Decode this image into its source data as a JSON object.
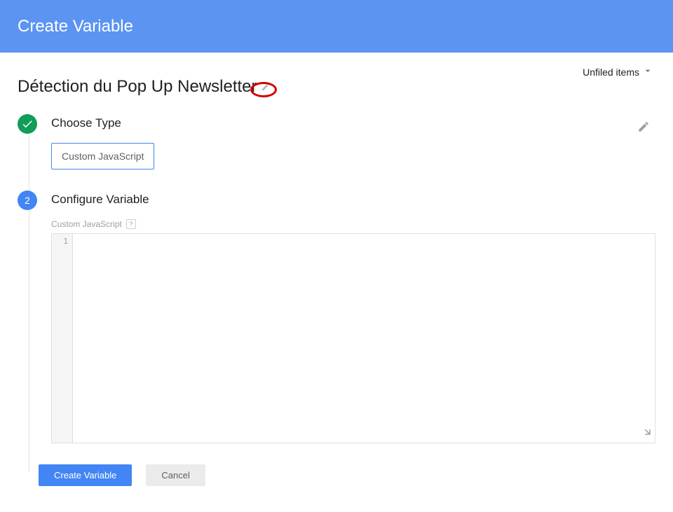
{
  "header": {
    "title": "Create Variable"
  },
  "folder": {
    "label": "Unfiled items"
  },
  "variable": {
    "name": "Détection du Pop Up Newsletter"
  },
  "steps": {
    "choose_type": {
      "title": "Choose Type",
      "selected_type": "Custom JavaScript"
    },
    "configure": {
      "badge": "2",
      "title": "Configure Variable",
      "field_label": "Custom JavaScript",
      "line_number": "1",
      "code": ""
    }
  },
  "buttons": {
    "create": "Create Variable",
    "cancel": "Cancel"
  }
}
